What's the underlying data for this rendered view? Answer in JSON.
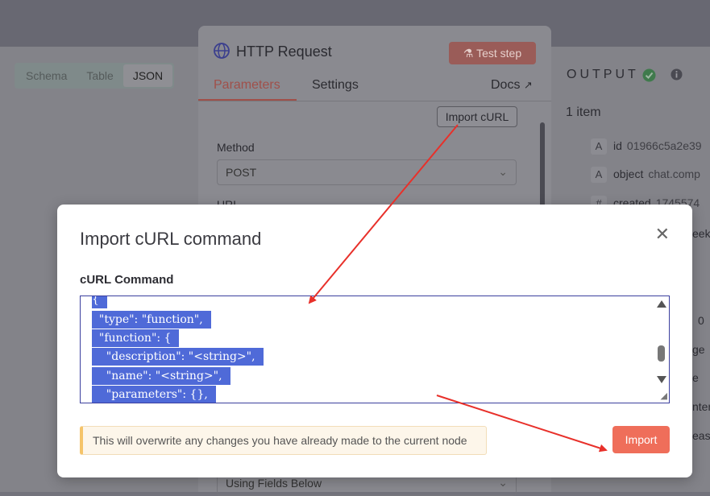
{
  "left_panel": {
    "tabs": [
      "Schema",
      "Table",
      "JSON"
    ],
    "active_tab": "JSON"
  },
  "node": {
    "title": "HTTP Request",
    "test_step": "Test step",
    "tabs": {
      "parameters": "Parameters",
      "settings": "Settings",
      "docs": "Docs"
    },
    "import_curl": "Import cURL",
    "method_label": "Method",
    "method_value": "POST",
    "url_label": "URL",
    "bottom_select": "Using Fields Below"
  },
  "output": {
    "title": "OUTPUT",
    "count": "1 item",
    "rows": [
      {
        "type": "A",
        "key": "id",
        "value": "01966c5a2e39"
      },
      {
        "type": "A",
        "key": "object",
        "value": "chat.comp"
      },
      {
        "type": "#",
        "key": "created",
        "value": "1745574"
      }
    ],
    "fragments": [
      "eek",
      "0",
      "ge",
      "e",
      "nten",
      "easo"
    ]
  },
  "modal": {
    "title": "Import cURL command",
    "field_label": "cURL Command",
    "code_lines": [
      "{",
      "  \"type\": \"function\",",
      "  \"function\": {",
      "    \"description\": \"<string>\",",
      "    \"name\": \"<string>\",",
      "    \"parameters\": {},"
    ],
    "warning": "This will overwrite any changes you have already made to the current node",
    "import_button": "Import"
  },
  "colors": {
    "accent": "#ef6e5a",
    "annotation_arrow": "#e8302a",
    "code_selection": "#4f6ad8"
  }
}
